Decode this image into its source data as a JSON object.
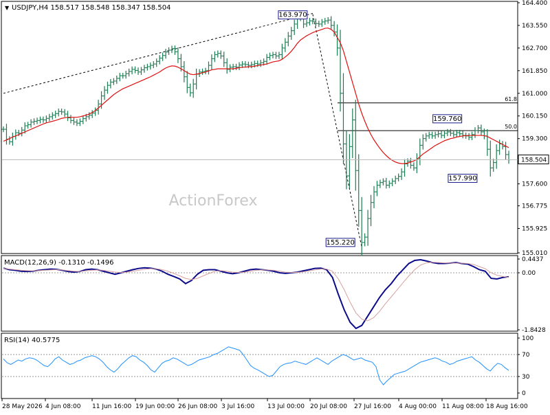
{
  "header": {
    "symbol_text": "USDJPY,H4  158.517 158.548 158.347 158.504",
    "watermark": "ActionForex"
  },
  "colors": {
    "bg": "#ffffff",
    "grid": "#000000",
    "bar": "#1a7a50",
    "ma": "#e01010",
    "macd_main": "#0a0a8a",
    "macd_signal": "#d8a0a0",
    "rsi": "#1e90ff",
    "fib": "#000000",
    "price_label_bg": "#ffffff",
    "annotation_border": "#1a1a8a",
    "watermark": "#c8c8c8"
  },
  "chart_data": [
    {
      "type": "candlestick",
      "title": "USDJPY,H4",
      "ohlc_last": {
        "open": 158.517,
        "high": 158.548,
        "low": 158.347,
        "close": 158.504
      },
      "yaxis_ticks": [
        "164.400",
        "163.550",
        "162.700",
        "161.850",
        "161.000",
        "160.150",
        "159.300",
        "158.450",
        "157.600",
        "156.775",
        "155.925",
        "155.010"
      ],
      "ylim": [
        155.01,
        164.4
      ],
      "current_price": "158.504",
      "xaxis_ticks": [
        "28 May 2026",
        "4 Jun 08:00",
        "11 Jun 16:00",
        "19 Jun 00:00",
        "26 Jun 08:00",
        "3 Jul 16:00",
        "13 Jul 00:00",
        "20 Jul 08:00",
        "27 Jul 16:00",
        "4 Aug 00:00",
        "11 Aug 08:00",
        "18 Aug 16:00"
      ],
      "annotations": [
        {
          "label": "163.970",
          "value": 163.97
        },
        {
          "label": "155.220",
          "value": 155.22
        },
        {
          "label": "159.760",
          "value": 159.76
        },
        {
          "label": "157.990",
          "value": 157.99
        }
      ],
      "fib_levels": [
        {
          "label": "61.8",
          "value": 160.64
        },
        {
          "label": "50.0",
          "value": 159.6
        }
      ],
      "close_path": [
        159.65,
        159.28,
        159.18,
        159.38,
        159.52,
        159.5,
        159.62,
        159.78,
        159.82,
        159.92,
        159.95,
        159.98,
        160.02,
        160.0,
        160.06,
        160.12,
        160.18,
        160.24,
        160.32,
        160.3,
        160.22,
        160.08,
        159.98,
        159.92,
        159.88,
        159.95,
        160.05,
        160.12,
        160.18,
        160.26,
        160.36,
        160.6,
        160.9,
        161.12,
        161.3,
        161.42,
        161.46,
        161.56,
        161.66,
        161.66,
        161.74,
        161.82,
        161.9,
        161.86,
        161.8,
        161.88,
        161.96,
        162.0,
        162.05,
        162.1,
        162.2,
        162.32,
        162.42,
        162.55,
        162.62,
        162.68,
        162.56,
        162.3,
        162.0,
        161.62,
        161.22,
        161.02,
        161.35,
        161.72,
        161.8,
        161.82,
        161.85,
        162.05,
        162.3,
        162.45,
        162.5,
        162.4,
        162.15,
        161.9,
        161.98,
        162.0,
        161.98,
        162.06,
        162.1,
        162.08,
        162.05,
        162.08,
        162.12,
        162.1,
        162.15,
        162.2,
        162.35,
        162.42,
        162.45,
        162.4,
        162.45,
        162.7,
        162.92,
        163.15,
        163.35,
        163.6,
        163.9,
        163.82,
        163.6,
        163.65,
        163.72,
        163.7,
        163.62,
        163.6,
        163.68,
        163.72,
        163.75,
        163.55,
        163.3,
        162.7,
        161.0,
        159.1,
        157.9,
        159.0,
        160.0,
        158.1,
        156.6,
        155.4,
        155.6,
        156.3,
        156.9,
        157.3,
        157.55,
        157.65,
        157.7,
        157.55,
        157.62,
        157.7,
        157.8,
        157.88,
        158.05,
        158.35,
        158.45,
        158.3,
        158.2,
        158.55,
        159.05,
        159.3,
        159.4,
        159.45,
        159.4,
        159.45,
        159.48,
        159.42,
        159.5,
        159.55,
        159.5,
        159.45,
        159.52,
        159.48,
        159.42,
        159.4,
        159.35,
        159.45,
        159.6,
        159.7,
        159.55,
        159.4,
        158.9,
        158.2,
        158.4,
        158.85,
        159.1,
        159.0,
        158.7,
        158.5
      ],
      "ma_path": [
        159.2,
        159.25,
        159.3,
        159.36,
        159.4,
        159.45,
        159.5,
        159.55,
        159.6,
        159.65,
        159.7,
        159.75,
        159.8,
        159.85,
        159.89,
        159.92,
        159.95,
        159.98,
        160.02,
        160.06,
        160.08,
        160.1,
        160.1,
        160.1,
        160.1,
        160.12,
        160.15,
        160.18,
        160.22,
        160.28,
        160.35,
        160.45,
        160.55,
        160.65,
        160.75,
        160.85,
        160.95,
        161.03,
        161.1,
        161.17,
        161.22,
        161.27,
        161.32,
        161.37,
        161.42,
        161.47,
        161.52,
        161.57,
        161.62,
        161.68,
        161.74,
        161.8,
        161.88,
        161.95,
        162.0,
        162.03,
        162.02,
        161.98,
        161.92,
        161.85,
        161.78,
        161.72,
        161.7,
        161.72,
        161.74,
        161.77,
        161.8,
        161.84,
        161.88,
        161.9,
        161.92,
        161.92,
        161.92,
        161.92,
        161.92,
        161.92,
        161.94,
        161.96,
        161.98,
        161.98,
        162.0,
        162.0,
        162.02,
        162.04,
        162.06,
        162.08,
        162.1,
        162.14,
        162.18,
        162.2,
        162.22,
        162.28,
        162.36,
        162.46,
        162.58,
        162.72,
        162.88,
        163.0,
        163.08,
        163.16,
        163.22,
        163.28,
        163.32,
        163.36,
        163.4,
        163.44,
        163.45,
        163.4,
        163.3,
        163.1,
        162.9,
        162.6,
        162.2,
        161.8,
        161.4,
        161.0,
        160.6,
        160.25,
        159.95,
        159.68,
        159.45,
        159.25,
        159.08,
        158.92,
        158.78,
        158.66,
        158.56,
        158.48,
        158.42,
        158.38,
        158.36,
        158.36,
        158.38,
        158.42,
        158.46,
        158.52,
        158.62,
        158.72,
        158.8,
        158.88,
        158.96,
        159.04,
        159.1,
        159.16,
        159.22,
        159.26,
        159.3,
        159.32,
        159.36,
        159.38,
        159.4,
        159.41,
        159.42,
        159.42,
        159.42,
        159.42,
        159.42,
        159.41,
        159.38,
        159.32,
        159.26,
        159.2,
        159.14,
        159.08,
        159.02,
        158.96
      ],
      "trendlines": [
        {
          "from": {
            "bar": 0,
            "value": 161.0
          },
          "to": {
            "bar": 101,
            "value": 164.0
          },
          "style": "dashed"
        },
        {
          "from": {
            "bar": 101,
            "value": 163.97
          },
          "to": {
            "bar": 117,
            "value": 155.22
          },
          "style": "dashed"
        }
      ]
    },
    {
      "type": "line",
      "title": "MACD(12,26,9) -0.1310 -0.1496",
      "yaxis_ticks": [
        "0.4437",
        "0.00",
        "-1.8428"
      ],
      "ylim": [
        -1.8428,
        0.4437
      ],
      "series": [
        {
          "name": "MACD",
          "values": [
            0.15,
            0.1,
            0.08,
            0.05,
            0.04,
            0.05,
            0.08,
            0.1,
            0.12,
            0.11,
            0.08,
            0.04,
            0.02,
            0.04,
            0.1,
            0.12,
            0.1,
            0.05,
            0.0,
            -0.05,
            0.0,
            0.05,
            0.1,
            0.14,
            0.16,
            0.15,
            0.12,
            0.05,
            -0.05,
            -0.12,
            -0.2,
            -0.35,
            -0.25,
            -0.05,
            0.08,
            0.1,
            0.1,
            0.05,
            0.0,
            -0.03,
            0.0,
            0.05,
            0.1,
            0.12,
            0.1,
            0.08,
            0.05,
            0.0,
            -0.02,
            0.0,
            0.02,
            0.06,
            0.1,
            0.14,
            0.15,
            0.1,
            -0.15,
            -0.7,
            -1.2,
            -1.6,
            -1.8,
            -1.7,
            -1.4,
            -1.1,
            -0.8,
            -0.55,
            -0.35,
            -0.1,
            0.1,
            0.3,
            0.4,
            0.42,
            0.38,
            0.33,
            0.3,
            0.3,
            0.31,
            0.33,
            0.3,
            0.28,
            0.2,
            0.1,
            0.05,
            -0.18,
            -0.2,
            -0.15,
            -0.13
          ]
        },
        {
          "name": "Signal",
          "values": [
            0.14,
            0.12,
            0.1,
            0.08,
            0.07,
            0.06,
            0.07,
            0.08,
            0.09,
            0.1,
            0.09,
            0.07,
            0.05,
            0.04,
            0.06,
            0.08,
            0.09,
            0.08,
            0.05,
            0.02,
            0.01,
            0.02,
            0.05,
            0.08,
            0.11,
            0.13,
            0.13,
            0.1,
            0.05,
            -0.02,
            -0.1,
            -0.18,
            -0.22,
            -0.18,
            -0.1,
            -0.02,
            0.05,
            0.07,
            0.05,
            0.02,
            0.01,
            0.02,
            0.05,
            0.08,
            0.09,
            0.09,
            0.08,
            0.05,
            0.02,
            0.01,
            0.01,
            0.03,
            0.06,
            0.09,
            0.12,
            0.12,
            0.05,
            -0.2,
            -0.55,
            -0.95,
            -1.3,
            -1.5,
            -1.55,
            -1.45,
            -1.25,
            -1.0,
            -0.78,
            -0.55,
            -0.32,
            -0.1,
            0.1,
            0.25,
            0.32,
            0.34,
            0.33,
            0.32,
            0.31,
            0.31,
            0.31,
            0.3,
            0.27,
            0.2,
            0.13,
            0.0,
            -0.08,
            -0.12,
            -0.15
          ]
        }
      ]
    },
    {
      "type": "line",
      "title": "RSI(14) 40.5775",
      "yaxis_ticks": [
        "100",
        "70",
        "30",
        "0"
      ],
      "ylim": [
        0,
        100
      ],
      "levels": [
        70,
        30
      ],
      "series": [
        {
          "name": "RSI",
          "values": [
            62,
            55,
            52,
            56,
            60,
            58,
            62,
            64,
            63,
            60,
            55,
            50,
            48,
            54,
            62,
            66,
            60,
            56,
            52,
            54,
            58,
            60,
            64,
            66,
            68,
            66,
            62,
            56,
            48,
            42,
            38,
            44,
            52,
            58,
            64,
            68,
            66,
            60,
            56,
            50,
            42,
            38,
            46,
            54,
            58,
            60,
            64,
            62,
            58,
            54,
            50,
            52,
            56,
            60,
            62,
            64,
            66,
            70,
            72,
            76,
            80,
            84,
            82,
            80,
            78,
            70,
            60,
            50,
            45,
            42,
            38,
            34,
            30,
            32,
            40,
            48,
            52,
            54,
            55,
            58,
            56,
            54,
            52,
            56,
            60,
            64,
            60,
            56,
            52,
            58,
            62,
            66,
            70,
            68,
            64,
            60,
            62,
            64,
            60,
            58,
            56,
            48,
            24,
            15,
            22,
            28,
            34,
            36,
            38,
            40,
            44,
            48,
            52,
            56,
            58,
            60,
            62,
            64,
            62,
            58,
            56,
            52,
            54,
            58,
            60,
            62,
            64,
            66,
            60,
            56,
            50,
            44,
            40,
            48,
            54,
            52,
            46,
            41
          ]
        }
      ]
    }
  ]
}
